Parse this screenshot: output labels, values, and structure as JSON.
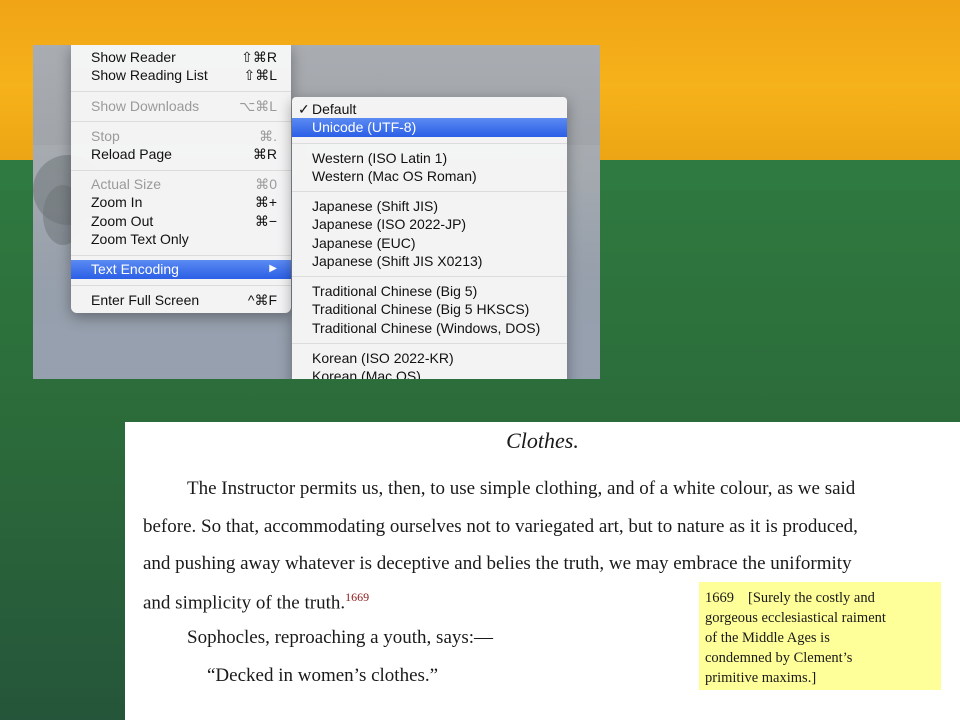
{
  "view_menu": {
    "items": [
      {
        "label": "Show Reader",
        "shortcut": "⇧⌘R",
        "disabled": false
      },
      {
        "label": "Show Reading List",
        "shortcut": "⇧⌘L",
        "disabled": false
      },
      {
        "label": "Show Downloads",
        "shortcut": "⌥⌘L",
        "disabled": true
      },
      {
        "label": "Stop",
        "shortcut": "⌘.",
        "disabled": true
      },
      {
        "label": "Reload Page",
        "shortcut": "⌘R",
        "disabled": false
      },
      {
        "label": "Actual Size",
        "shortcut": "⌘0",
        "disabled": true
      },
      {
        "label": "Zoom In",
        "shortcut": "⌘+",
        "disabled": false
      },
      {
        "label": "Zoom Out",
        "shortcut": "⌘−",
        "disabled": false
      },
      {
        "label": "Zoom Text Only",
        "shortcut": "",
        "disabled": false
      },
      {
        "label": "Text Encoding",
        "shortcut": "▶",
        "selected": true
      },
      {
        "label": "Enter Full Screen",
        "shortcut": "^⌘F",
        "disabled": false
      }
    ]
  },
  "encoding_menu": {
    "checkmark": "✓",
    "items": [
      "Default",
      "Unicode (UTF-8)",
      "Western (ISO Latin 1)",
      "Western (Mac OS Roman)",
      "Japanese (Shift JIS)",
      "Japanese (ISO 2022-JP)",
      "Japanese (EUC)",
      "Japanese (Shift JIS X0213)",
      "Traditional Chinese (Big 5)",
      "Traditional Chinese (Big 5 HKSCS)",
      "Traditional Chinese (Windows, DOS)",
      "Korean (ISO 2022-KR)",
      "Korean (Mac OS)"
    ]
  },
  "document": {
    "title": "Clothes.",
    "lines": [
      "The Instructor permits us, then, to use simple clothing, and of a white colour, as we said",
      "before. So that, accommodating ourselves not to variegated art, but to nature as it is produced,",
      "and pushing away whatever is deceptive and belies the truth, we may embrace the uniformity",
      "and simplicity of the truth."
    ],
    "footnote_ref": "1669",
    "line5": "Sophocles, reproaching a youth, says:—",
    "line6": "“Decked in women’s clothes.”",
    "note": {
      "number": "1669",
      "lines": [
        "[Surely the costly and",
        "gorgeous ecclesiastical raiment",
        "of the Middle Ages is",
        "condemned by Clement’s",
        "primitive maxims.]"
      ]
    }
  },
  "colors": {
    "highlight": "#2b5fe6",
    "note_bg": "#ffff99",
    "footnote_ref": "#8b1a1a"
  }
}
